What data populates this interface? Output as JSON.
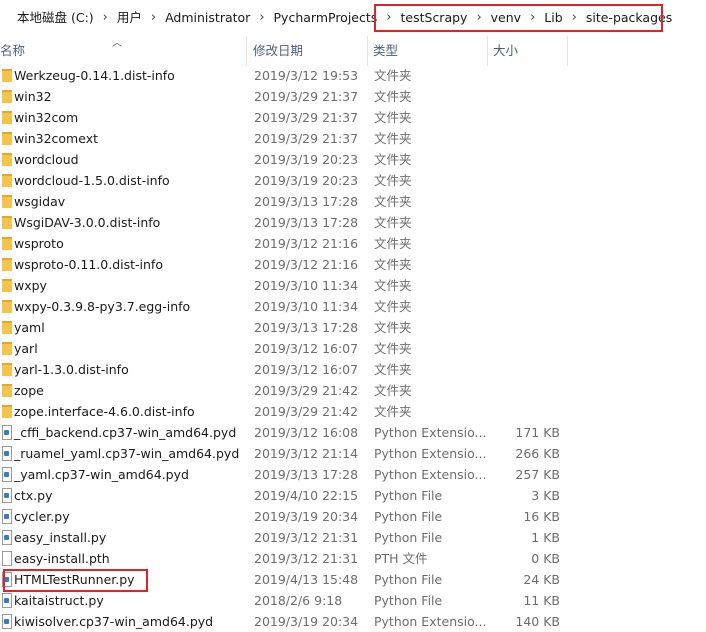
{
  "breadcrumb": [
    "本地磁盘 (C:)",
    "用户",
    "Administrator",
    "PycharmProjects",
    "testScrapy",
    "venv",
    "Lib",
    "site-packages"
  ],
  "columns": {
    "name": "名称",
    "date": "修改日期",
    "type": "类型",
    "size": "大小"
  },
  "files": [
    {
      "name": "Werkzeug-0.14.1.dist-info",
      "date": "2019/3/12 19:53",
      "type": "文件夹",
      "size": "",
      "icon": "folder"
    },
    {
      "name": "win32",
      "date": "2019/3/29 21:37",
      "type": "文件夹",
      "size": "",
      "icon": "folder"
    },
    {
      "name": "win32com",
      "date": "2019/3/29 21:37",
      "type": "文件夹",
      "size": "",
      "icon": "folder"
    },
    {
      "name": "win32comext",
      "date": "2019/3/29 21:37",
      "type": "文件夹",
      "size": "",
      "icon": "folder"
    },
    {
      "name": "wordcloud",
      "date": "2019/3/19 20:23",
      "type": "文件夹",
      "size": "",
      "icon": "folder"
    },
    {
      "name": "wordcloud-1.5.0.dist-info",
      "date": "2019/3/19 20:23",
      "type": "文件夹",
      "size": "",
      "icon": "folder"
    },
    {
      "name": "wsgidav",
      "date": "2019/3/13 17:28",
      "type": "文件夹",
      "size": "",
      "icon": "folder"
    },
    {
      "name": "WsgiDAV-3.0.0.dist-info",
      "date": "2019/3/13 17:28",
      "type": "文件夹",
      "size": "",
      "icon": "folder"
    },
    {
      "name": "wsproto",
      "date": "2019/3/12 21:16",
      "type": "文件夹",
      "size": "",
      "icon": "folder"
    },
    {
      "name": "wsproto-0.11.0.dist-info",
      "date": "2019/3/12 21:16",
      "type": "文件夹",
      "size": "",
      "icon": "folder"
    },
    {
      "name": "wxpy",
      "date": "2019/3/10 11:34",
      "type": "文件夹",
      "size": "",
      "icon": "folder"
    },
    {
      "name": "wxpy-0.3.9.8-py3.7.egg-info",
      "date": "2019/3/10 11:34",
      "type": "文件夹",
      "size": "",
      "icon": "folder"
    },
    {
      "name": "yaml",
      "date": "2019/3/13 17:28",
      "type": "文件夹",
      "size": "",
      "icon": "folder"
    },
    {
      "name": "yarl",
      "date": "2019/3/12 16:07",
      "type": "文件夹",
      "size": "",
      "icon": "folder"
    },
    {
      "name": "yarl-1.3.0.dist-info",
      "date": "2019/3/12 16:07",
      "type": "文件夹",
      "size": "",
      "icon": "folder"
    },
    {
      "name": "zope",
      "date": "2019/3/29 21:42",
      "type": "文件夹",
      "size": "",
      "icon": "folder"
    },
    {
      "name": "zope.interface-4.6.0.dist-info",
      "date": "2019/3/29 21:42",
      "type": "文件夹",
      "size": "",
      "icon": "folder"
    },
    {
      "name": "_cffi_backend.cp37-win_amd64.pyd",
      "date": "2019/3/12 16:08",
      "type": "Python Extensio...",
      "size": "171 KB",
      "icon": "python"
    },
    {
      "name": "_ruamel_yaml.cp37-win_amd64.pyd",
      "date": "2019/3/12 21:14",
      "type": "Python Extensio...",
      "size": "266 KB",
      "icon": "python"
    },
    {
      "name": "_yaml.cp37-win_amd64.pyd",
      "date": "2019/3/13 17:28",
      "type": "Python Extensio...",
      "size": "257 KB",
      "icon": "python"
    },
    {
      "name": "ctx.py",
      "date": "2019/4/10 22:15",
      "type": "Python File",
      "size": "3 KB",
      "icon": "python"
    },
    {
      "name": "cycler.py",
      "date": "2019/3/19 20:34",
      "type": "Python File",
      "size": "16 KB",
      "icon": "python"
    },
    {
      "name": "easy_install.py",
      "date": "2019/3/12 21:31",
      "type": "Python File",
      "size": "1 KB",
      "icon": "python"
    },
    {
      "name": "easy-install.pth",
      "date": "2019/3/12 21:31",
      "type": "PTH 文件",
      "size": "0 KB",
      "icon": "file"
    },
    {
      "name": "HTMLTestRunner.py",
      "date": "2019/4/13 15:48",
      "type": "Python File",
      "size": "24 KB",
      "icon": "python"
    },
    {
      "name": "kaitaistruct.py",
      "date": "2018/2/6 9:18",
      "type": "Python File",
      "size": "11 KB",
      "icon": "python"
    },
    {
      "name": "kiwisolver.cp37-win_amd64.pyd",
      "date": "2019/3/19 20:34",
      "type": "Python Extensio...",
      "size": "140 KB",
      "icon": "python"
    }
  ]
}
